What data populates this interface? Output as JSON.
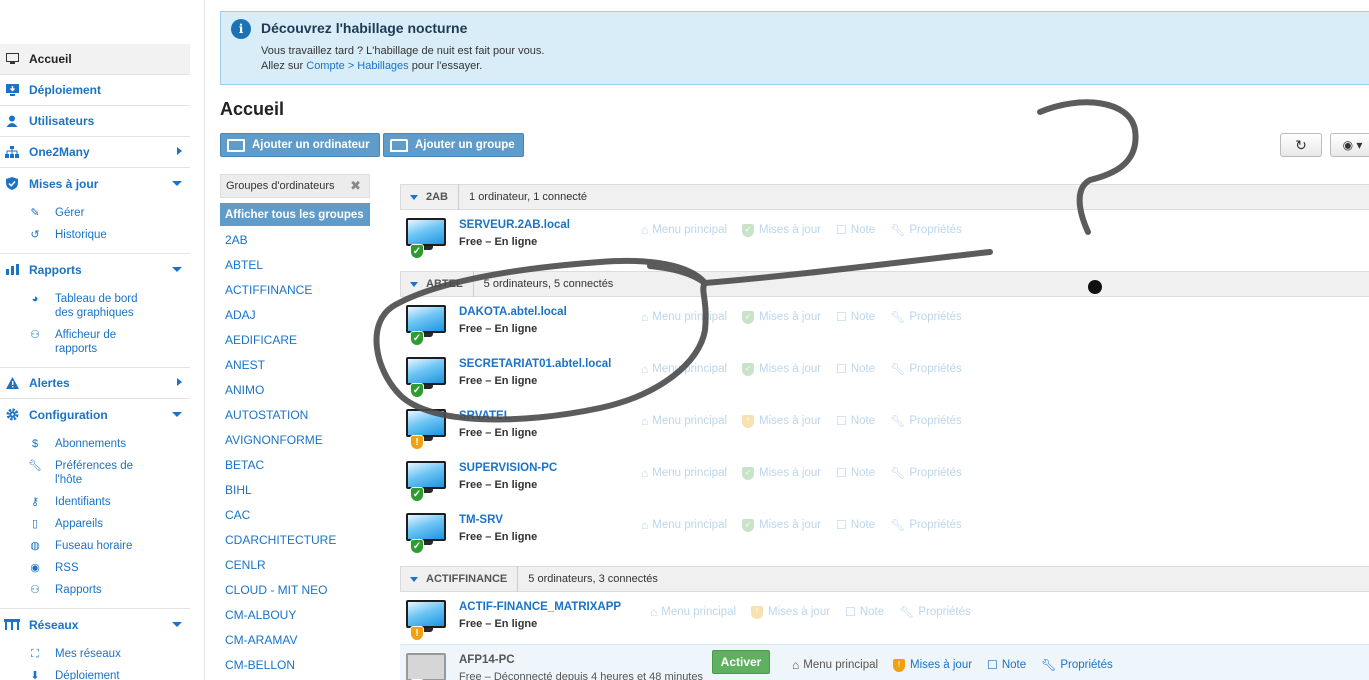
{
  "nav": {
    "accueil": "Accueil",
    "deploiement": "Déploiement",
    "utilisateurs": "Utilisateurs",
    "one2many": "One2Many",
    "mises_a_jour": "Mises à jour",
    "mises_sub": [
      "Gérer",
      "Historique"
    ],
    "rapports": "Rapports",
    "rapports_sub": [
      "Tableau de bord des graphiques",
      "Afficheur de rapports"
    ],
    "alertes": "Alertes",
    "configuration": "Configuration",
    "configuration_sub": [
      "Abonnements",
      "Préférences de l'hôte",
      "Identifiants",
      "Appareils",
      "Fuseau horaire",
      "RSS",
      "Rapports"
    ],
    "reseaux": "Réseaux",
    "reseaux_sub": [
      "Mes réseaux",
      "Déploiement"
    ]
  },
  "alert": {
    "title": "Découvrez l'habillage nocturne",
    "line1": "Vous travaillez tard ? L'habillage de nuit est fait pour vous.",
    "line2_prefix": "Allez sur ",
    "line2_link": "Compte > Habillages",
    "line2_suffix": " pour l'essayer."
  },
  "page": {
    "title": "Accueil",
    "add_computer": "Ajouter un ordinateur",
    "add_group": "Ajouter un groupe"
  },
  "group_panel": {
    "header": "Groupes d'ordinateurs",
    "show_all": "Afficher tous les groupes",
    "groups": [
      "2AB",
      "ABTEL",
      "ACTIFFINANCE",
      "ADAJ",
      "AEDIFICARE",
      "ANEST",
      "ANIMO",
      "AUTOSTATION",
      "AVIGNONFORME",
      "BETAC",
      "BIHL",
      "CAC",
      "CDARCHITECTURE",
      "CENLR",
      "CLOUD - MIT NEO",
      "CM-ALBOUY",
      "CM-ARAMAV",
      "CM-BELLON"
    ]
  },
  "actions": {
    "menu": "Menu principal",
    "updates": "Mises à jour",
    "note": "Note",
    "props": "Propriétés",
    "activate": "Activer"
  },
  "groups": [
    {
      "name": "2AB",
      "count": "1 ordinateur, 1 connecté",
      "computers": [
        {
          "host": "SERVEUR.2AB.local",
          "status": "Free – En ligne",
          "state": "ok"
        }
      ]
    },
    {
      "name": "ABTEL",
      "count": "5 ordinateurs, 5 connectés",
      "computers": [
        {
          "host": "DAKOTA.abtel.local",
          "status": "Free – En ligne",
          "state": "ok"
        },
        {
          "host": "SECRETARIAT01.abtel.local",
          "status": "Free – En ligne",
          "state": "ok"
        },
        {
          "host": "SRVATEL",
          "status": "Free – En ligne",
          "state": "warn"
        },
        {
          "host": "SUPERVISION-PC",
          "status": "Free – En ligne",
          "state": "ok"
        },
        {
          "host": "TM-SRV",
          "status": "Free – En ligne",
          "state": "ok"
        }
      ]
    },
    {
      "name": "ACTIFFINANCE",
      "count": "5 ordinateurs, 3 connectés",
      "computers": [
        {
          "host": "ACTIF-FINANCE_MATRIXAPP",
          "status": "Free – En ligne",
          "state": "warn"
        },
        {
          "host": "AFP14-PC",
          "status": "Free – Déconnecté depuis 4 heures et 48 minutes",
          "state": "warn"
        }
      ]
    }
  ]
}
